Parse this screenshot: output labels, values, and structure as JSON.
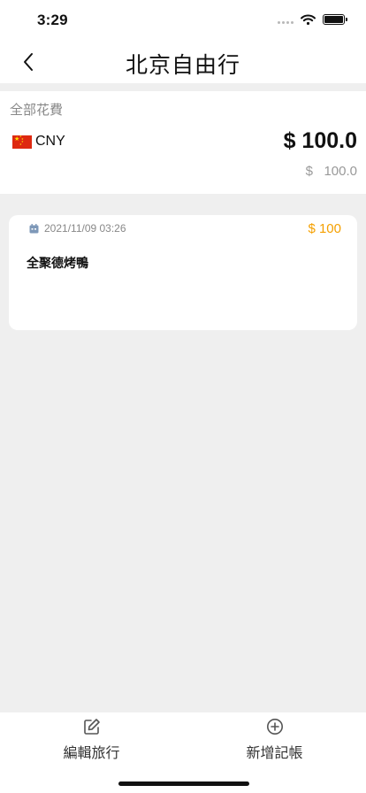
{
  "status_bar": {
    "time": "3:29"
  },
  "header": {
    "title": "北京自由行"
  },
  "summary": {
    "label": "全部花費",
    "currency_code": "CNY",
    "total": "$ 100.0",
    "converted_total": "$   100.0"
  },
  "expenses": [
    {
      "date": "2021/11/09 03:26",
      "amount": "$ 100",
      "title": "全聚德烤鴨"
    }
  ],
  "bottom_bar": {
    "edit_label": "編輯旅行",
    "add_label": "新增記帳"
  },
  "colors": {
    "accent_amount": "#f5a000",
    "date_icon": "#7e98b8",
    "background": "#efefef"
  },
  "icons": [
    "chevron-left-icon",
    "calendar-icon",
    "edit-icon",
    "add-circle-icon",
    "wifi-icon",
    "battery-icon"
  ]
}
